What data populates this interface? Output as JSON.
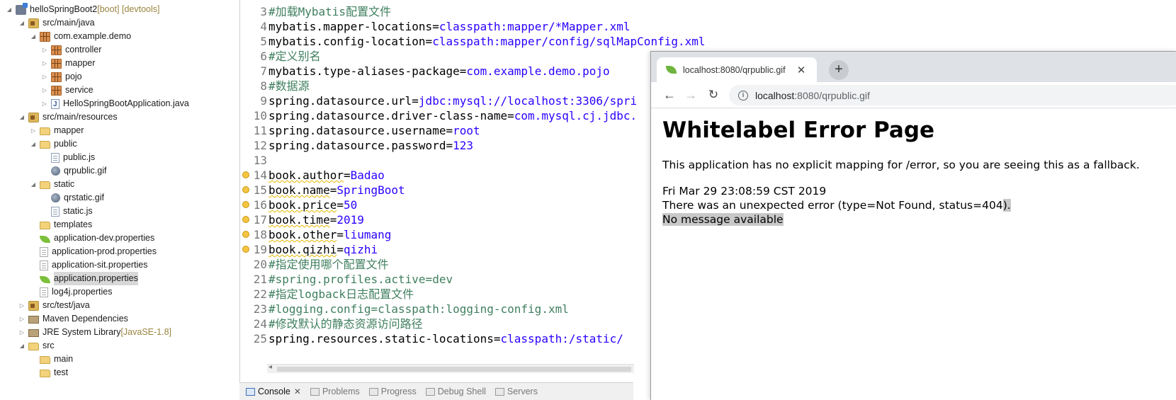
{
  "explorer": {
    "items": [
      {
        "label": "helloSpringBoot2",
        "decor": " [boot] [devtools]",
        "icon": "project-icon"
      },
      {
        "label": "src/main/java",
        "icon": "source-folder-icon"
      },
      {
        "label": "com.example.demo",
        "icon": "package-icon"
      },
      {
        "label": "controller",
        "icon": "package-icon"
      },
      {
        "label": "mapper",
        "icon": "package-icon"
      },
      {
        "label": "pojo",
        "icon": "package-icon"
      },
      {
        "label": "service",
        "icon": "package-icon"
      },
      {
        "label": "HelloSpringBootApplication.java",
        "icon": "java-file-icon"
      },
      {
        "label": "src/main/resources",
        "icon": "source-folder-icon"
      },
      {
        "label": "mapper",
        "icon": "folder-icon"
      },
      {
        "label": "public",
        "icon": "folder-icon"
      },
      {
        "label": "public.js",
        "icon": "js-file-icon"
      },
      {
        "label": "qrpublic.gif",
        "icon": "image-file-icon"
      },
      {
        "label": "static",
        "icon": "folder-icon"
      },
      {
        "label": "qrstatic.gif",
        "icon": "image-file-icon"
      },
      {
        "label": "static.js",
        "icon": "js-file-icon"
      },
      {
        "label": "templates",
        "icon": "folder-icon"
      },
      {
        "label": "application-dev.properties",
        "icon": "spring-leaf-icon"
      },
      {
        "label": "application-prod.properties",
        "icon": "properties-file-icon"
      },
      {
        "label": "application-sit.properties",
        "icon": "properties-file-icon"
      },
      {
        "label": "application.properties",
        "icon": "spring-leaf-icon"
      },
      {
        "label": "log4j.properties",
        "icon": "properties-file-icon"
      },
      {
        "label": "src/test/java",
        "icon": "source-folder-icon"
      },
      {
        "label": "Maven Dependencies",
        "icon": "library-icon"
      },
      {
        "label": "JRE System Library",
        "decor": " [JavaSE-1.8]",
        "icon": "library-icon"
      },
      {
        "label": "src",
        "icon": "folder-icon"
      },
      {
        "label": "main",
        "icon": "folder-icon"
      },
      {
        "label": "test",
        "icon": "folder-icon"
      }
    ]
  },
  "editor": {
    "lines": [
      {
        "num": "3",
        "key": "#加载Mybatis配置文件",
        "val": "",
        "comment": true
      },
      {
        "num": "4",
        "key": "mybatis.mapper-locations=",
        "val": "classpath:mapper/*Mapper.xml"
      },
      {
        "num": "5",
        "key": "mybatis.config-location=",
        "val": "classpath:mapper/config/sqlMapConfig.xml"
      },
      {
        "num": "6",
        "key": "#定义别名",
        "val": "",
        "comment": true
      },
      {
        "num": "7",
        "key": "mybatis.type-aliases-package=",
        "val": "com.example.demo.pojo"
      },
      {
        "num": "8",
        "key": "#数据源",
        "val": "",
        "comment": true
      },
      {
        "num": "9",
        "key": "spring.datasource.url=",
        "val": "jdbc:mysql://localhost:3306/spri"
      },
      {
        "num": "10",
        "key": "spring.datasource.driver-class-name=",
        "val": "com.mysql.cj.jdbc."
      },
      {
        "num": "11",
        "key": "spring.datasource.username=",
        "val": "root"
      },
      {
        "num": "12",
        "key": "spring.datasource.password=",
        "val": "123"
      },
      {
        "num": "13",
        "key": "",
        "val": ""
      },
      {
        "num": "14",
        "key": "book.author",
        "eq": "=",
        "val": "Badao",
        "warn": true
      },
      {
        "num": "15",
        "key": "book.name",
        "eq": "=",
        "val": "SpringBoot",
        "warn": true
      },
      {
        "num": "16",
        "key": "book.price",
        "eq": "=",
        "val": "50",
        "warn": true
      },
      {
        "num": "17",
        "key": "book.time",
        "eq": "=",
        "val": "2019",
        "warn": true
      },
      {
        "num": "18",
        "key": "book.other",
        "eq": "=",
        "val": "liumang",
        "warn": true
      },
      {
        "num": "19",
        "key": "book.qizhi",
        "eq": "=",
        "val": "qizhi",
        "warn": true
      },
      {
        "num": "20",
        "key": "#指定使用哪个配置文件",
        "val": "",
        "comment": true
      },
      {
        "num": "21",
        "key": "#spring.profiles.active=dev",
        "val": "",
        "comment": true
      },
      {
        "num": "22",
        "key": "#指定logback日志配置文件",
        "val": "",
        "comment": true
      },
      {
        "num": "23",
        "key": "#logging.config=classpath:logging-config.xml",
        "val": "",
        "comment": true
      },
      {
        "num": "24",
        "key": "#修改默认的静态资源访问路径",
        "val": "",
        "comment": true
      },
      {
        "num": "25",
        "key": "spring.resources.static-locations=",
        "val": "classpath:/static/"
      }
    ]
  },
  "views": {
    "tabs": [
      {
        "label": "Console",
        "active": true
      },
      {
        "label": "Problems"
      },
      {
        "label": "Progress"
      },
      {
        "label": "Debug Shell"
      },
      {
        "label": "Servers"
      }
    ],
    "close_glyph": "✕"
  },
  "browser": {
    "tab_title": "localhost:8080/qrpublic.gif",
    "tab_close": "✕",
    "new_tab": "+",
    "back": "←",
    "forward": "→",
    "reload": "↻",
    "url_host": "localhost",
    "url_path": ":8080/qrpublic.gif",
    "page": {
      "heading": "Whitelabel Error Page",
      "explanation": "This application has no explicit mapping for /error, so you are seeing this as a fallback.",
      "timestamp": "Fri Mar 29 23:08:59 CST 2019",
      "error_line": "There was an unexpected error (type=Not Found, status=404",
      "error_tail": ").",
      "message": "No message available"
    }
  }
}
